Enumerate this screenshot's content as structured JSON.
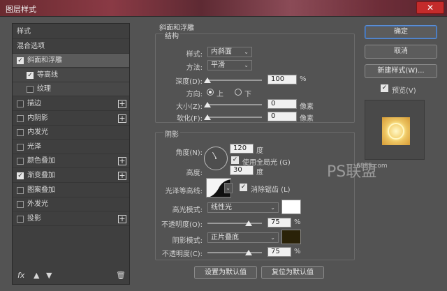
{
  "window": {
    "title": "图层样式",
    "close_icon": "close-icon"
  },
  "left_panel": {
    "items": [
      {
        "label": "样式",
        "checkbox": null,
        "plus": false,
        "state": "normal"
      },
      {
        "label": "混合选项",
        "checkbox": null,
        "plus": false,
        "state": "normal"
      },
      {
        "label": "斜面和浮雕",
        "checkbox": true,
        "plus": false,
        "state": "selected"
      },
      {
        "label": "等高线",
        "checkbox": true,
        "plus": false,
        "state": "sub"
      },
      {
        "label": "纹理",
        "checkbox": false,
        "plus": false,
        "state": "sub"
      },
      {
        "label": "描边",
        "checkbox": false,
        "plus": true,
        "state": "normal"
      },
      {
        "label": "内阴影",
        "checkbox": false,
        "plus": true,
        "state": "normal"
      },
      {
        "label": "内发光",
        "checkbox": false,
        "plus": false,
        "state": "normal"
      },
      {
        "label": "光泽",
        "checkbox": false,
        "plus": false,
        "state": "normal"
      },
      {
        "label": "颜色叠加",
        "checkbox": false,
        "plus": true,
        "state": "normal"
      },
      {
        "label": "渐变叠加",
        "checkbox": true,
        "plus": true,
        "state": "normal"
      },
      {
        "label": "图案叠加",
        "checkbox": false,
        "plus": false,
        "state": "normal"
      },
      {
        "label": "外发光",
        "checkbox": false,
        "plus": false,
        "state": "normal"
      },
      {
        "label": "投影",
        "checkbox": false,
        "plus": true,
        "state": "normal"
      }
    ],
    "bottom": {
      "fx_label": "fx",
      "up_icon": "arrow-up-icon",
      "down_icon": "arrow-down-icon",
      "trash_icon": "trash-icon"
    }
  },
  "bevel": {
    "section_title": "斜面和浮雕",
    "structure": {
      "title": "结构",
      "style_label": "样式:",
      "style_value": "内斜面",
      "technique_label": "方法:",
      "technique_value": "平滑",
      "depth_label": "深度(D):",
      "depth_value": "100",
      "depth_unit": "%",
      "depth_level": 1.0,
      "direction_label": "方向:",
      "direction_up": "上",
      "direction_down": "下",
      "direction_selected": "上",
      "size_label": "大小(Z):",
      "size_value": "0",
      "size_unit": "像素",
      "soften_label": "软化(F):",
      "soften_value": "0",
      "soften_unit": "像素"
    },
    "shading": {
      "title": "阴影",
      "angle_label": "角度(N):",
      "angle_value": "120",
      "angle_unit": "度",
      "global_light_label": "使用全局光 (G)",
      "global_light_checked": true,
      "altitude_label": "高度:",
      "altitude_value": "30",
      "altitude_unit": "度",
      "gloss_contour_label": "光泽等高线:",
      "anti_alias_label": "消除锯齿 (L)",
      "anti_alias_checked": true,
      "highlight_mode_label": "高光模式:",
      "highlight_mode_value": "线性光",
      "highlight_color": "#ffffff",
      "highlight_opacity_label": "不透明度(O):",
      "highlight_opacity_value": "75",
      "highlight_opacity_unit": "%",
      "shadow_mode_label": "阴影模式:",
      "shadow_mode_value": "正片叠底",
      "shadow_color": "#2a2208",
      "shadow_opacity_label": "不透明度(C):",
      "shadow_opacity_value": "75",
      "shadow_opacity_unit": "%"
    },
    "make_default": "设置为默认值",
    "reset_default": "复位为默认值"
  },
  "right_panel": {
    "ok": "确定",
    "cancel": "取消",
    "new_style": "新建样式(W)...",
    "preview_label": "预览(V)",
    "preview_checked": true
  },
  "watermark": {
    "site": "68PS.com",
    "logo": "PS联盟"
  }
}
